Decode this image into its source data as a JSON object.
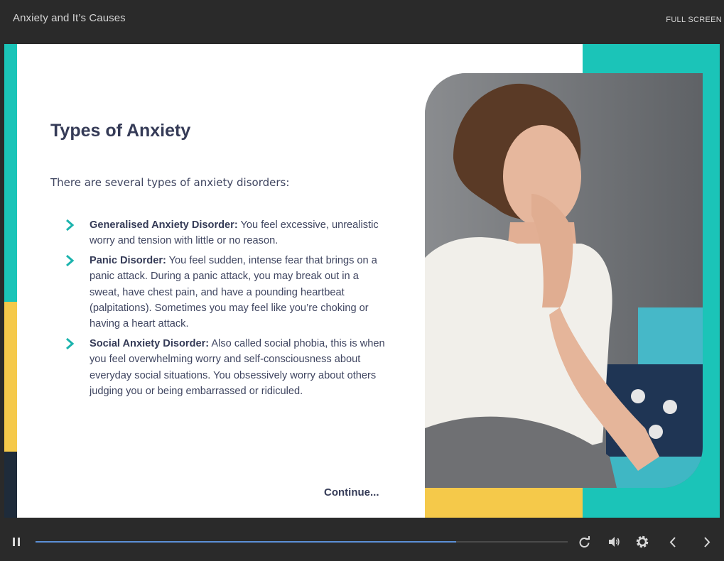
{
  "header": {
    "title": "Anxiety and It’s Causes",
    "fullscreen_label": "FULL SCREEN"
  },
  "slide": {
    "title": "Types of Anxiety",
    "intro": "There are several types of anxiety disorders:",
    "items": [
      {
        "term": "Generalised Anxiety Disorder:",
        "text": " You feel excessive, unrealistic worry and tension with little or no reason."
      },
      {
        "term": "Panic Disorder:",
        "text": " You feel sudden, intense fear that brings on a panic attack. During a panic attack, you may break out in a sweat, have chest pain, and have a pounding heartbeat (palpitations). Sometimes you may feel like you’re choking or having a heart attack."
      },
      {
        "term": "Social Anxiety Disorder:",
        "text": " Also called social phobia, this is when you feel overwhelming worry and self-consciousness about everyday social situations. You obsessively worry about others judging you or being embarrassed or ridiculed."
      }
    ],
    "continue_label": "Continue...",
    "colors": {
      "teal": "#1bc4b8",
      "yellow": "#f5c94a",
      "navy": "#1e2b3a",
      "heading": "#353b57"
    }
  },
  "player": {
    "progress": 0.79,
    "icons": [
      "pause-icon",
      "replay-icon",
      "volume-icon",
      "settings-icon",
      "prev-icon",
      "next-icon"
    ],
    "accent": "#5b8fd6"
  }
}
